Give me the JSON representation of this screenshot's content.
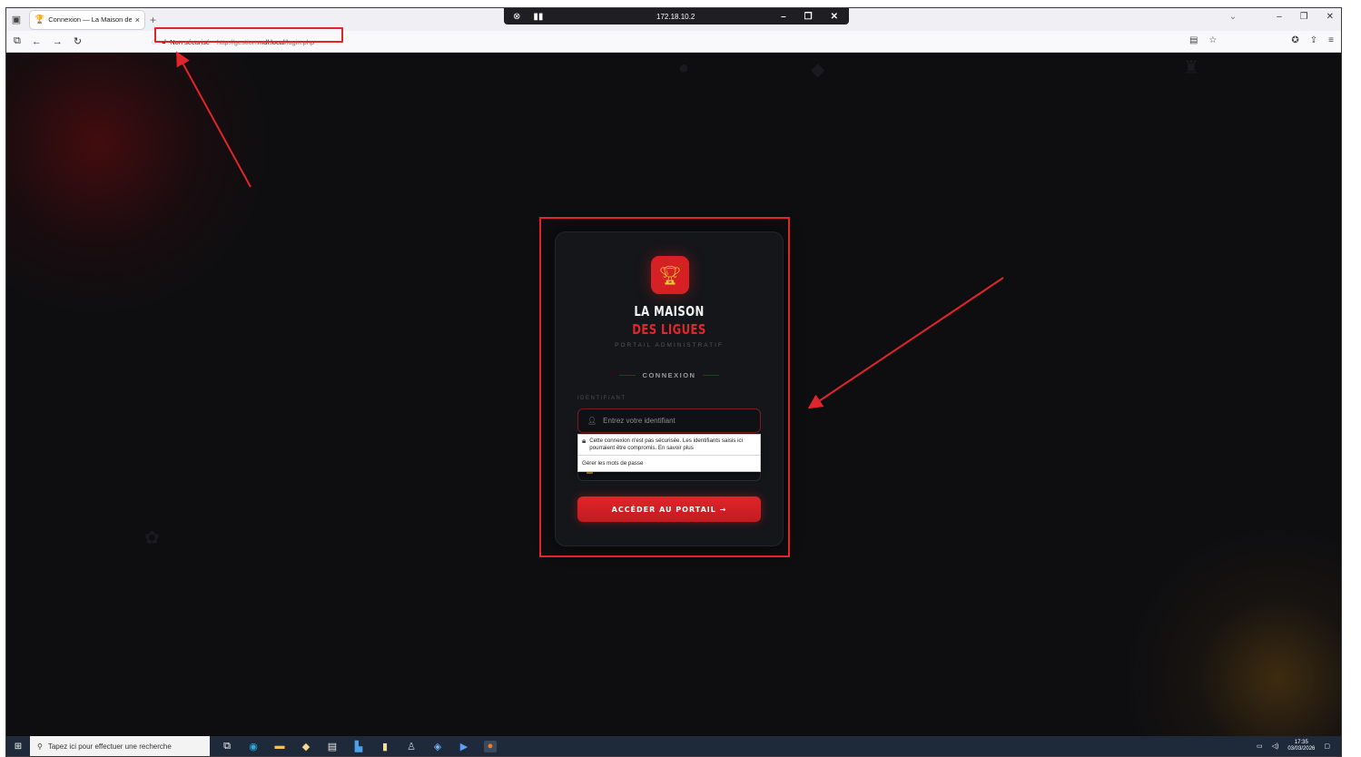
{
  "browser": {
    "tab_title": "Connexion — La Maison des Li",
    "tab_close": "×",
    "new_tab": "+",
    "remote_ip": "172.18.10.2",
    "security_label": "Non sécurisé",
    "url_prefix": "http://gestion.",
    "url_domain": "mdl.local",
    "url_path": "/login.php"
  },
  "login": {
    "brand_line1": "LA MAISON",
    "brand_line2": "DES LIGUES",
    "subtitle": "PORTAIL ADMINISTRATIF",
    "section_title": "CONNEXION",
    "identifier_label": "IDENTIFIANT",
    "identifier_placeholder": "Entrez votre identifiant",
    "autofill_warning": "Cette connexion n'est pas sécurisée. Les identifiants saisis ici pourraient être compromis. En savoir plus",
    "manage_passwords": "Gérer les mots de passe",
    "submit_label": "ACCÉDER AU PORTAIL →"
  },
  "taskbar": {
    "search_placeholder": "Tapez ici pour effectuer une recherche",
    "time": "17:35",
    "date": "03/03/2026"
  },
  "colors": {
    "accent": "#e0262a",
    "background": "#0e0e11",
    "card": "#15161a",
    "brand_red": "#e3262b",
    "logo_gold": "#f3c33a"
  },
  "icons": {
    "logo": "trophy-icon",
    "identifier": "user-icon",
    "warning": "lock-icon"
  }
}
